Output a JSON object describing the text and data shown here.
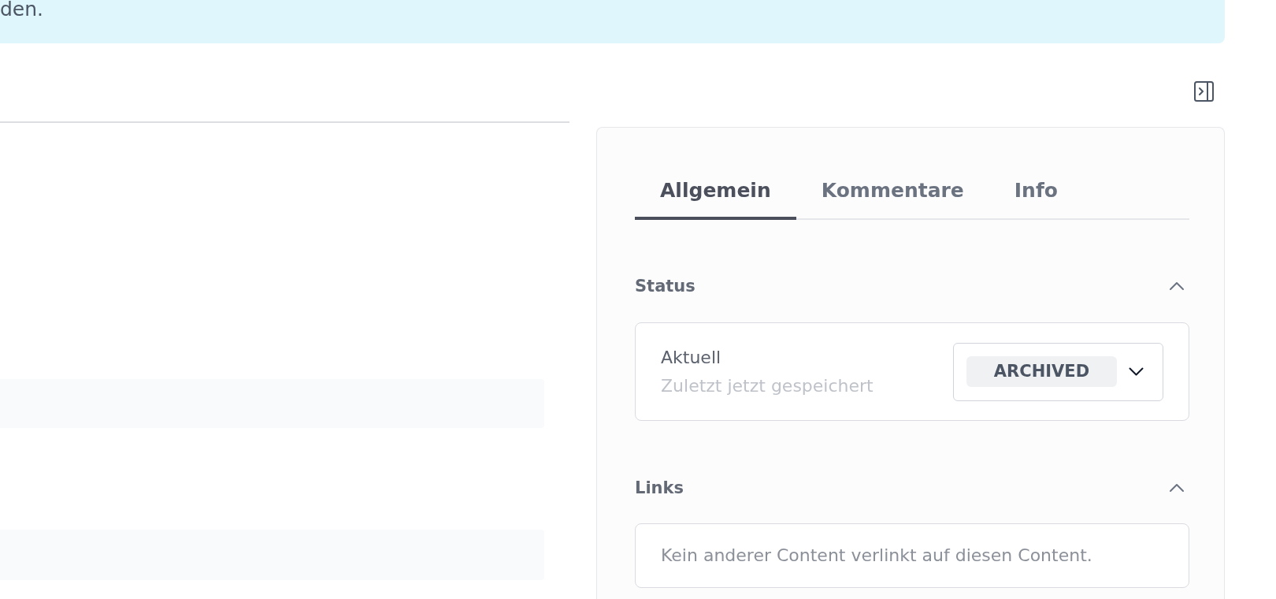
{
  "banner": {
    "text": "den."
  },
  "sidebar": {
    "tabs": [
      {
        "label": "Allgemein",
        "selected": true
      },
      {
        "label": "Kommentare",
        "selected": false
      },
      {
        "label": "Info",
        "selected": false
      }
    ],
    "sections": [
      {
        "kind": "status",
        "title": "Status",
        "expanded": true,
        "label": "Aktuell",
        "hint": "Zuletzt jetzt gespeichert",
        "value": "ARCHIVED"
      },
      {
        "kind": "message",
        "title": "Links",
        "expanded": true,
        "text": "Kein anderer Content verlinkt auf diesen Content."
      }
    ]
  }
}
